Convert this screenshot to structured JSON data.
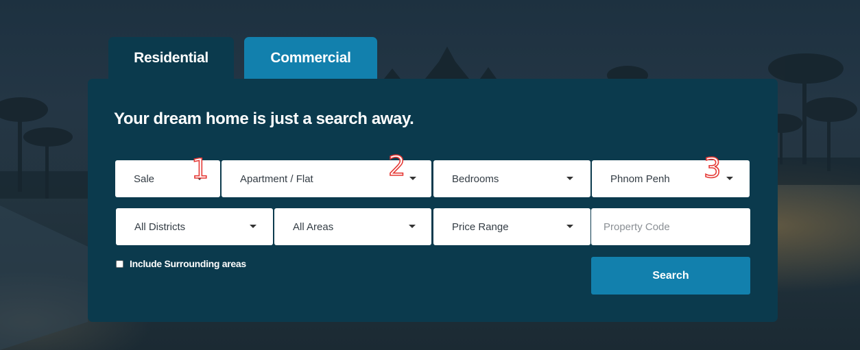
{
  "tabs": {
    "residential": "Residential",
    "commercial": "Commercial"
  },
  "headline": "Your dream home is just a search away.",
  "filters": {
    "sale": "Sale",
    "property_type": "Apartment / Flat",
    "bedrooms": "Bedrooms",
    "city": "Phnom Penh",
    "districts": "All Districts",
    "areas": "All Areas",
    "price_range": "Price Range",
    "property_code_placeholder": "Property Code"
  },
  "include_surrounding_label": "Include Surrounding areas",
  "search_label": "Search",
  "markers": [
    "1",
    "2",
    "3"
  ],
  "colors": {
    "panel": "#0b3a4d",
    "accent": "#1280ad",
    "marker_outline": "#e53935"
  }
}
